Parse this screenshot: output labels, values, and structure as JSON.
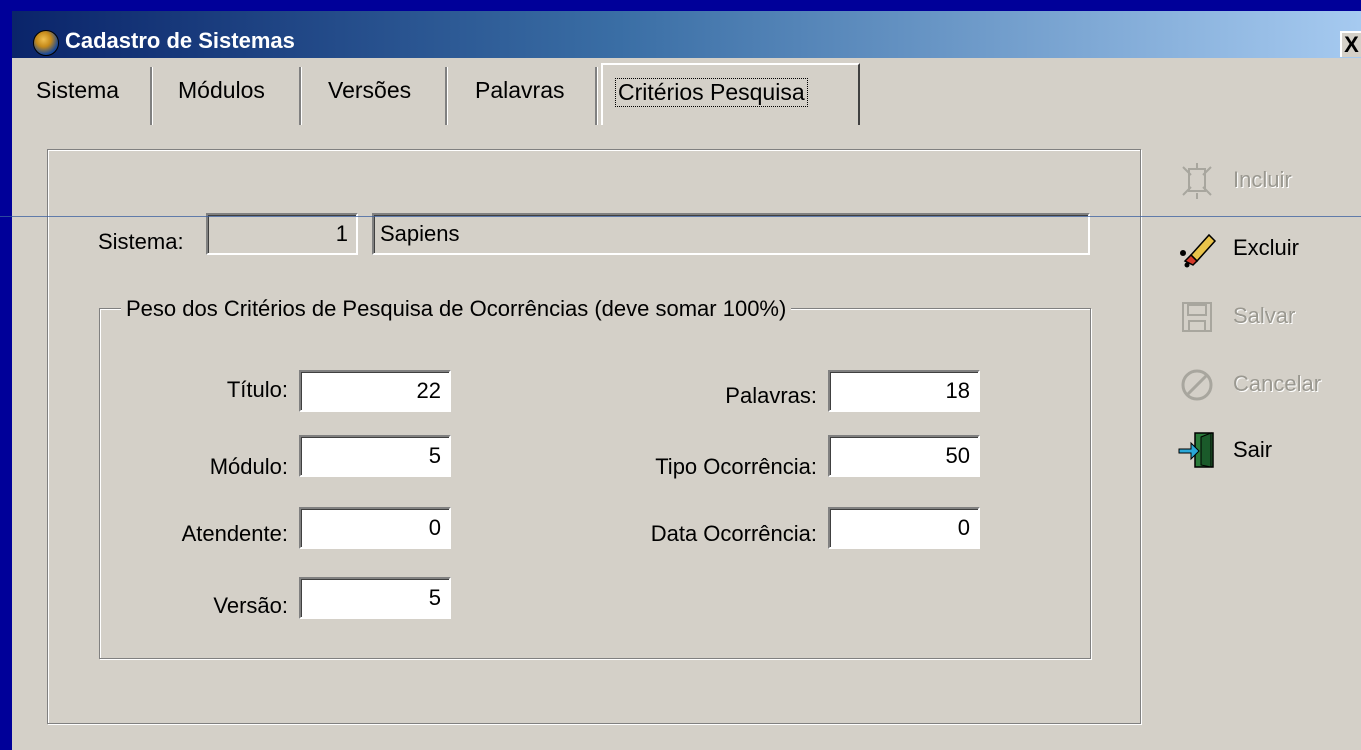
{
  "window": {
    "title": "Cadastro de Sistemas",
    "close_label": "X"
  },
  "tabs": [
    {
      "label": "Sistema"
    },
    {
      "label": "Módulos"
    },
    {
      "label": "Versões"
    },
    {
      "label": "Palavras"
    },
    {
      "label": "Critérios Pesquisa",
      "active": true
    }
  ],
  "sistema": {
    "label": "Sistema:",
    "code": "1",
    "name": "Sapiens"
  },
  "criteria": {
    "group_title": "Peso dos Critérios de Pesquisa de Ocorrências (deve somar 100%)",
    "fields": [
      {
        "label": "Título:",
        "value": "22"
      },
      {
        "label": "Módulo:",
        "value": "5"
      },
      {
        "label": "Atendente:",
        "value": "0"
      },
      {
        "label": "Versão:",
        "value": "5"
      },
      {
        "label": "Palavras:",
        "value": "18"
      },
      {
        "label": "Tipo Ocorrência:",
        "value": "50"
      },
      {
        "label": "Data Ocorrência:",
        "value": "0"
      }
    ]
  },
  "actions": [
    {
      "label": "Incluir",
      "icon": "new-record-icon",
      "enabled": false
    },
    {
      "label": "Excluir",
      "icon": "eraser-icon",
      "enabled": true
    },
    {
      "label": "Salvar",
      "icon": "floppy-disk-icon",
      "enabled": false
    },
    {
      "label": "Cancelar",
      "icon": "cancel-icon",
      "enabled": false
    },
    {
      "label": "Sair",
      "icon": "exit-door-icon",
      "enabled": true
    }
  ]
}
